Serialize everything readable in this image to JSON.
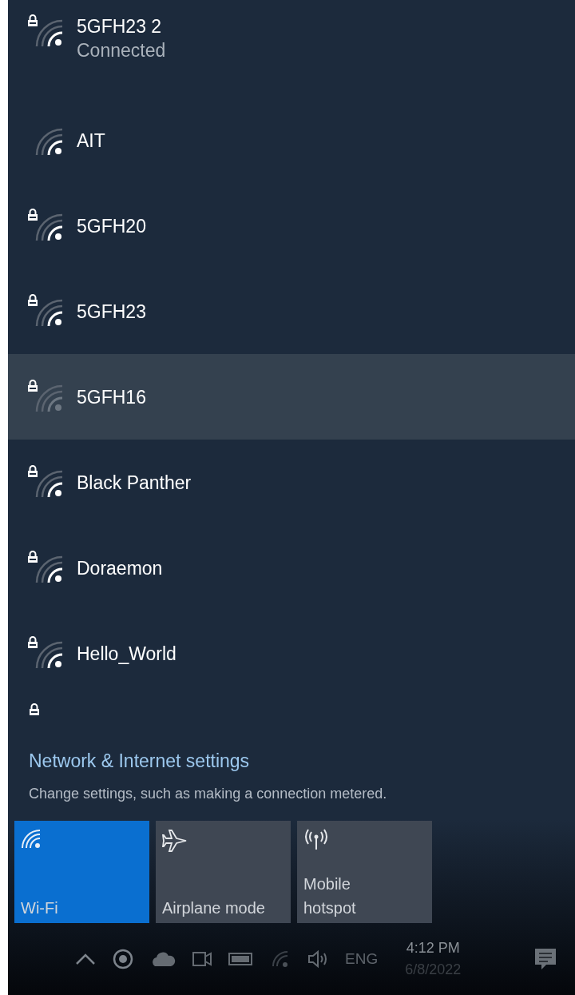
{
  "networks": [
    {
      "name": "5GFH23 2",
      "status": "Connected",
      "secured": true,
      "selected": false
    },
    {
      "name": "AIT",
      "secured": false,
      "selected": false
    },
    {
      "name": "5GFH20",
      "secured": true,
      "selected": false
    },
    {
      "name": "5GFH23",
      "secured": true,
      "selected": false
    },
    {
      "name": "5GFH16",
      "secured": true,
      "selected": true
    },
    {
      "name": "Black Panther",
      "secured": true,
      "selected": false
    },
    {
      "name": "Doraemon",
      "secured": true,
      "selected": false
    },
    {
      "name": "Hello_World",
      "secured": true,
      "selected": false
    }
  ],
  "partial_network": {
    "secured": true
  },
  "settings": {
    "link": "Network & Internet settings",
    "description": "Change settings, such as making a connection metered."
  },
  "tiles": [
    {
      "kind": "wifi",
      "label": "Wi-Fi",
      "on": true
    },
    {
      "kind": "airplane",
      "label": "Airplane mode",
      "on": false
    },
    {
      "kind": "hotspot",
      "label": "Mobile\nhotspot",
      "on": false
    }
  ],
  "taskbar": {
    "language": "ENG",
    "time": "4:12 PM",
    "date": "6/8/2022"
  }
}
